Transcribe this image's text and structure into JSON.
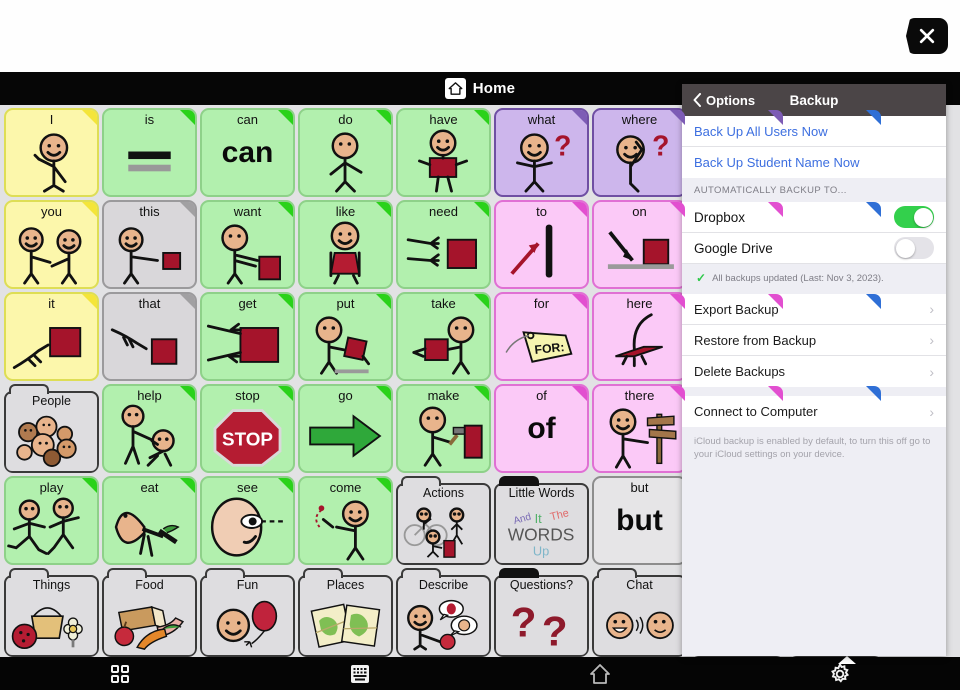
{
  "header": {
    "title": "Home",
    "home_icon": "home-icon"
  },
  "close_button": {
    "icon": "close-x-icon"
  },
  "toolbar": {
    "items": [
      {
        "name": "grid-view-button",
        "icon": "grid-icon"
      },
      {
        "name": "keyboard-button",
        "icon": "keyboard-icon"
      },
      {
        "name": "home-button",
        "icon": "home-outline-icon"
      },
      {
        "name": "settings-button",
        "icon": "gear-icon"
      }
    ]
  },
  "grid": {
    "columns": 9,
    "cells": [
      {
        "label": "I",
        "color": "yellow",
        "art": "person-pointing-self",
        "folder": false
      },
      {
        "label": "is",
        "color": "green",
        "art": "equals-bars",
        "folder": false
      },
      {
        "label": "can",
        "color": "green",
        "art": "text-can",
        "text": "can",
        "folder": false
      },
      {
        "label": "do",
        "color": "green",
        "art": "person-doing",
        "folder": false
      },
      {
        "label": "have",
        "color": "green",
        "art": "person-holding",
        "folder": false
      },
      {
        "label": "what",
        "color": "purple",
        "art": "person-question",
        "folder": false
      },
      {
        "label": "where",
        "color": "purple",
        "art": "person-looking-question",
        "folder": false
      },
      {
        "label": "",
        "color": "purple",
        "art": "hidden",
        "folder": false
      },
      {
        "label": "",
        "color": "blue",
        "art": "hidden",
        "folder": false
      },
      {
        "label": "you",
        "color": "yellow",
        "art": "two-people-pointing",
        "folder": false
      },
      {
        "label": "this",
        "color": "gray",
        "art": "person-pointing-object",
        "folder": false
      },
      {
        "label": "want",
        "color": "green",
        "art": "person-reaching-box",
        "folder": false
      },
      {
        "label": "like",
        "color": "green",
        "art": "person-hugging-box",
        "folder": false
      },
      {
        "label": "need",
        "color": "green",
        "art": "hands-reaching-box",
        "folder": false
      },
      {
        "label": "to",
        "color": "lightpink",
        "art": "arrow-to-bar",
        "folder": false
      },
      {
        "label": "on",
        "color": "lightpink",
        "art": "arrow-onto-surface",
        "folder": false
      },
      {
        "label": "",
        "color": "lightpink",
        "art": "hidden",
        "folder": false
      },
      {
        "label": "",
        "color": "blue",
        "art": "hidden",
        "folder": false
      },
      {
        "label": "it",
        "color": "yellow",
        "art": "hand-pointing-square",
        "folder": false
      },
      {
        "label": "that",
        "color": "gray",
        "art": "hand-pointing-far-square",
        "folder": false
      },
      {
        "label": "get",
        "color": "green",
        "art": "hands-grabbing-box",
        "folder": false
      },
      {
        "label": "put",
        "color": "green",
        "art": "person-putting-box",
        "folder": false
      },
      {
        "label": "take",
        "color": "green",
        "art": "person-taking-box",
        "folder": false
      },
      {
        "label": "for",
        "color": "lightpink",
        "art": "for-tag",
        "folder": false
      },
      {
        "label": "here",
        "color": "lightpink",
        "art": "hand-tapping-here",
        "folder": false
      },
      {
        "label": "",
        "color": "lightpink",
        "art": "hidden",
        "folder": false
      },
      {
        "label": "",
        "color": "blue",
        "art": "hidden",
        "folder": false
      },
      {
        "label": "People",
        "color": "white",
        "art": "group-of-faces",
        "folder": true
      },
      {
        "label": "help",
        "color": "green",
        "art": "person-helping-person",
        "folder": false
      },
      {
        "label": "stop",
        "color": "green",
        "art": "stop-sign",
        "folder": false
      },
      {
        "label": "go",
        "color": "green",
        "art": "green-arrow",
        "folder": false
      },
      {
        "label": "make",
        "color": "green",
        "art": "person-hammering",
        "folder": false
      },
      {
        "label": "of",
        "color": "lightpink",
        "art": "text-of",
        "text": "of",
        "folder": false
      },
      {
        "label": "there",
        "color": "lightpink",
        "art": "person-pointing-signpost",
        "folder": false
      },
      {
        "label": "",
        "color": "lightpink",
        "art": "hidden",
        "folder": false
      },
      {
        "label": "",
        "color": "blue",
        "art": "hidden",
        "folder": false
      },
      {
        "label": "play",
        "color": "green",
        "art": "two-people-running",
        "folder": false
      },
      {
        "label": "eat",
        "color": "green",
        "art": "face-eating-carrot",
        "folder": false
      },
      {
        "label": "see",
        "color": "green",
        "art": "face-eye-looking",
        "folder": false
      },
      {
        "label": "come",
        "color": "green",
        "art": "person-beckoning",
        "folder": false
      },
      {
        "label": "Actions",
        "color": "white",
        "art": "bike-walk-actions",
        "folder": true
      },
      {
        "label": "Little Words",
        "color": "white",
        "art": "word-cloud",
        "folder": true,
        "dark_tab": true
      },
      {
        "label": "but",
        "color": "white",
        "art": "text-but",
        "text": "but",
        "folder": false
      },
      {
        "label": "",
        "color": "white",
        "art": "hidden",
        "folder": true
      },
      {
        "label": "",
        "color": "white",
        "art": "hidden",
        "folder": true
      },
      {
        "label": "Things",
        "color": "white",
        "art": "ball-basket-flower",
        "folder": true
      },
      {
        "label": "Food",
        "color": "white",
        "art": "bread-apple-carrot",
        "folder": true
      },
      {
        "label": "Fun",
        "color": "white",
        "art": "face-balloon",
        "folder": true
      },
      {
        "label": "Places",
        "color": "white",
        "art": "maps",
        "folder": true
      },
      {
        "label": "Describe",
        "color": "white",
        "art": "person-speech-bubbles",
        "folder": true
      },
      {
        "label": "Questions?",
        "color": "white",
        "art": "two-question-marks",
        "folder": true,
        "dark_tab": true
      },
      {
        "label": "Chat",
        "color": "white",
        "art": "two-faces-talking",
        "folder": true
      },
      {
        "label": "",
        "color": "white",
        "art": "hidden",
        "folder": true
      },
      {
        "label": "",
        "color": "white",
        "art": "hidden",
        "folder": true
      }
    ],
    "word_cloud": {
      "w1": "And",
      "w2": "It",
      "w3": "The",
      "w4": "WORDS",
      "w5": "Up"
    },
    "stop_text": "STOP",
    "for_tag_text": "FOR:"
  },
  "panel": {
    "back_label": "Options",
    "title": "Backup",
    "actions": [
      {
        "label": "Back Up All Users Now"
      },
      {
        "label": "Back Up Student Name Now"
      }
    ],
    "section_label": "Automatically Backup To...",
    "toggles": [
      {
        "label": "Dropbox",
        "on": true
      },
      {
        "label": "Google Drive",
        "on": false
      }
    ],
    "status": {
      "check": "✓",
      "text": "All backups updated (Last: Nov 3, 2023)."
    },
    "nav_items": [
      {
        "label": "Export Backup",
        "chevron": "›"
      },
      {
        "label": "Restore from Backup",
        "chevron": "›"
      },
      {
        "label": "Delete Backups",
        "chevron": "›"
      }
    ],
    "connect_item": {
      "label": "Connect to Computer",
      "chevron": "›"
    },
    "note": "iCloud backup is enabled by default, to turn this off go to your iCloud settings on your device."
  },
  "colors": {
    "yellow": "#fcf7ab",
    "green": "#b2f0ae",
    "gray": "#d9d7da",
    "purple": "#cdb6ec",
    "pink": "#fbc9f7",
    "blue": "#b8d4fb",
    "toggle_on": "#33d04c",
    "link": "#3d6fe0",
    "panel_header": "#4b4547"
  }
}
